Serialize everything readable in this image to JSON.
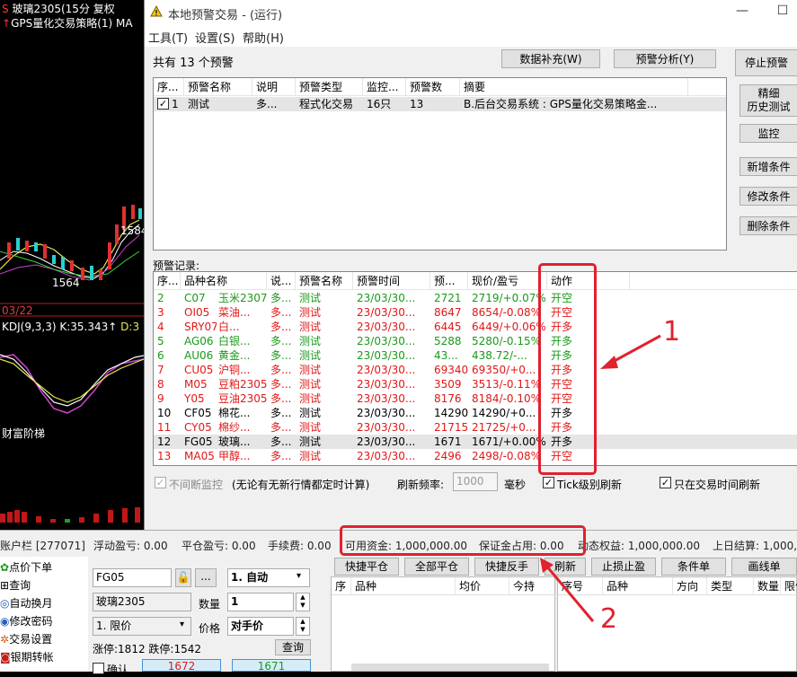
{
  "chart": {
    "header_prefix": "S",
    "header": "玻璃2305(15分 复权",
    "subheader_arrow": "↑",
    "subheader": "GPS量化交易策略(1) MA",
    "price_1584": "1584",
    "price_1564": "1564",
    "date": "03/22",
    "kdj": "KDJ(9,3,3) K:35.343",
    "kdj_arrow": "↑",
    "kdj_d": "D:3",
    "wealth": "财富阶梯"
  },
  "window": {
    "title": "本地预警交易  - (运行)",
    "menu": [
      "工具(T)",
      "设置(S)",
      "帮助(H)"
    ],
    "minimize": "—",
    "maximize": "☐",
    "total_alerts": "共有 13 个预警",
    "btn_data_fill": "数据补充(W)",
    "btn_alert_analysis": "预警分析(Y)",
    "btn_stop_alert": "停止预警",
    "btn_precise_history": "精细",
    "btn_precise_history2": "历史测试",
    "btn_monitor": "监控",
    "btn_add_cond": "新增条件",
    "btn_edit_cond": "修改条件",
    "btn_delete_cond": "删除条件",
    "alert_table": {
      "headers": [
        "序...",
        "预警名称",
        "说明",
        "预警类型",
        "监控...",
        "预警数",
        "摘要"
      ],
      "rows": [
        {
          "check": "✓",
          "no": "1",
          "name": "测试",
          "desc": "多...",
          "type": "程式化交易",
          "monitor": "16只",
          "count": "13",
          "summary": "B.后台交易系统 : GPS量化交易策略金..."
        }
      ]
    },
    "records_label": "预警记录:",
    "records_table": {
      "headers": [
        "序...",
        "品种名称",
        "说...",
        "预警名称",
        "预警时间",
        "预...",
        "现价/盈亏",
        "动作"
      ],
      "rows": [
        {
          "no": "2",
          "code": "C07",
          "name": "玉米2307",
          "desc": "多...",
          "alert": "测试",
          "time": "23/03/30...",
          "price": "2721",
          "cur": "2719/+0.07%",
          "action": "开空",
          "color": "#1a9a1a"
        },
        {
          "no": "3",
          "code": "OI05",
          "name": "菜油...",
          "desc": "多...",
          "alert": "测试",
          "time": "23/03/30...",
          "price": "8647",
          "cur": "8654/-0.08%",
          "action": "开空",
          "color": "#e01818"
        },
        {
          "no": "4",
          "code": "SRY07",
          "name": "白...",
          "desc": "多...",
          "alert": "测试",
          "time": "23/03/30...",
          "price": "6445",
          "cur": "6449/+0.06%",
          "action": "开多",
          "color": "#e01818"
        },
        {
          "no": "5",
          "code": "AG06",
          "name": "白银...",
          "desc": "多...",
          "alert": "测试",
          "time": "23/03/30...",
          "price": "5288",
          "cur": "5280/-0.15%",
          "action": "开多",
          "color": "#1a9a1a"
        },
        {
          "no": "6",
          "code": "AU06",
          "name": "黄金...",
          "desc": "多...",
          "alert": "测试",
          "time": "23/03/30...",
          "price": "43...",
          "cur": "438.72/-...",
          "action": "开多",
          "color": "#1a9a1a"
        },
        {
          "no": "7",
          "code": "CU05",
          "name": "沪铜...",
          "desc": "多...",
          "alert": "测试",
          "time": "23/03/30...",
          "price": "69340",
          "cur": "69350/+0...",
          "action": "开多",
          "color": "#e01818"
        },
        {
          "no": "8",
          "code": "M05",
          "name": "豆粕2305",
          "desc": "多...",
          "alert": "测试",
          "time": "23/03/30...",
          "price": "3509",
          "cur": "3513/-0.11%",
          "action": "开空",
          "color": "#e01818"
        },
        {
          "no": "9",
          "code": "Y05",
          "name": "豆油2305",
          "desc": "多...",
          "alert": "测试",
          "time": "23/03/30...",
          "price": "8176",
          "cur": "8184/-0.10%",
          "action": "开空",
          "color": "#e01818"
        },
        {
          "no": "10",
          "code": "CF05",
          "name": "棉花...",
          "desc": "多...",
          "alert": "测试",
          "time": "23/03/30...",
          "price": "14290",
          "cur": "14290/+0...",
          "action": "开多",
          "color": "#000000"
        },
        {
          "no": "11",
          "code": "CY05",
          "name": "棉纱...",
          "desc": "多...",
          "alert": "测试",
          "time": "23/03/30...",
          "price": "21715",
          "cur": "21725/+0...",
          "action": "开多",
          "color": "#e01818"
        },
        {
          "no": "12",
          "code": "FG05",
          "name": "玻璃...",
          "desc": "多...",
          "alert": "测试",
          "time": "23/03/30...",
          "price": "1671",
          "cur": "1671/+0.00%",
          "action": "开多",
          "color": "#000000"
        },
        {
          "no": "13",
          "code": "MA05",
          "name": "甲醇...",
          "desc": "多...",
          "alert": "测试",
          "time": "23/03/30...",
          "price": "2496",
          "cur": "2498/-0.08%",
          "action": "开空",
          "color": "#e01818"
        }
      ]
    },
    "continuous_monitor": "不间断监控",
    "continuous_note": "(无论有无新行情都定时计算)",
    "refresh_rate_label": "刷新频率:",
    "refresh_rate_value": "1000",
    "ms": "毫秒",
    "tick_refresh": "Tick级别刷新",
    "trade_time_refresh": "只在交易时间刷新"
  },
  "annotations": {
    "one": "1",
    "two": "2"
  },
  "account": {
    "label": "账户栏 [277071]",
    "float_pl": "浮动盈亏: 0.00",
    "close_pl": "平仓盈亏: 0.00",
    "fee": "手续费: 0.00",
    "available": "可用资金: 1,000,000.00",
    "margin": "保证金占用: 0.00",
    "dynamic": "动态权益: 1,000,000.00",
    "settle": "上日结算: 1,000,"
  },
  "leftnav": [
    "点价下单",
    "查询",
    "自动换月",
    "修改密码",
    "交易设置",
    "银期转帐"
  ],
  "order": {
    "code": "FG05",
    "mode": "1. 自动",
    "name": "玻璃2305",
    "qty_label": "数量",
    "qty": "1",
    "price_type": "1. 限价",
    "price_label": "价格",
    "price": "对手价",
    "limits": "涨停:1812 跌停:1542",
    "query": "查询",
    "confirm": "确认",
    "bid": "1672",
    "ask": "1671",
    "dots": "..."
  },
  "quick": {
    "buttons": [
      "快捷平仓",
      "全部平仓",
      "快捷反手",
      "刷新",
      "止损止盈",
      "条件单",
      "画线单"
    ],
    "pos_headers": [
      "序",
      "品种",
      "均价",
      "今持"
    ],
    "order_headers": [
      "序号",
      "品种",
      "方向",
      "类型",
      "数量",
      "限价"
    ]
  }
}
